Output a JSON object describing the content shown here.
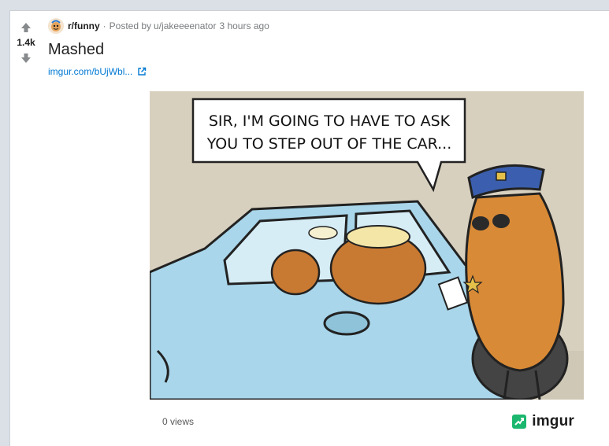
{
  "post": {
    "score": "1.4k",
    "subreddit": "r/funny",
    "posted_by": "Posted by",
    "author": "u/jakeeeenator",
    "time": "3 hours ago",
    "title": "Mashed",
    "link_text": "imgur.com/bUjWbl...",
    "comic": {
      "speech_line1": "SIR, I'M GOING TO HAVE TO ASK",
      "speech_line2": "YOU TO STEP OUT OF THE CAR..."
    }
  },
  "embed": {
    "views": "0 views",
    "brand": "imgur"
  },
  "colors": {
    "page_bg": "#dae0e6",
    "link": "#0079d3",
    "car": "#a9d6ea",
    "potato": "#d98a36",
    "cap": "#3b5fae",
    "imgur_green": "#1bb76e"
  },
  "icons": {
    "upvote": "upvote-icon",
    "downvote": "downvote-icon",
    "subreddit": "subreddit-avatar-icon",
    "external": "external-link-icon",
    "imgur": "imgur-logo-icon"
  }
}
